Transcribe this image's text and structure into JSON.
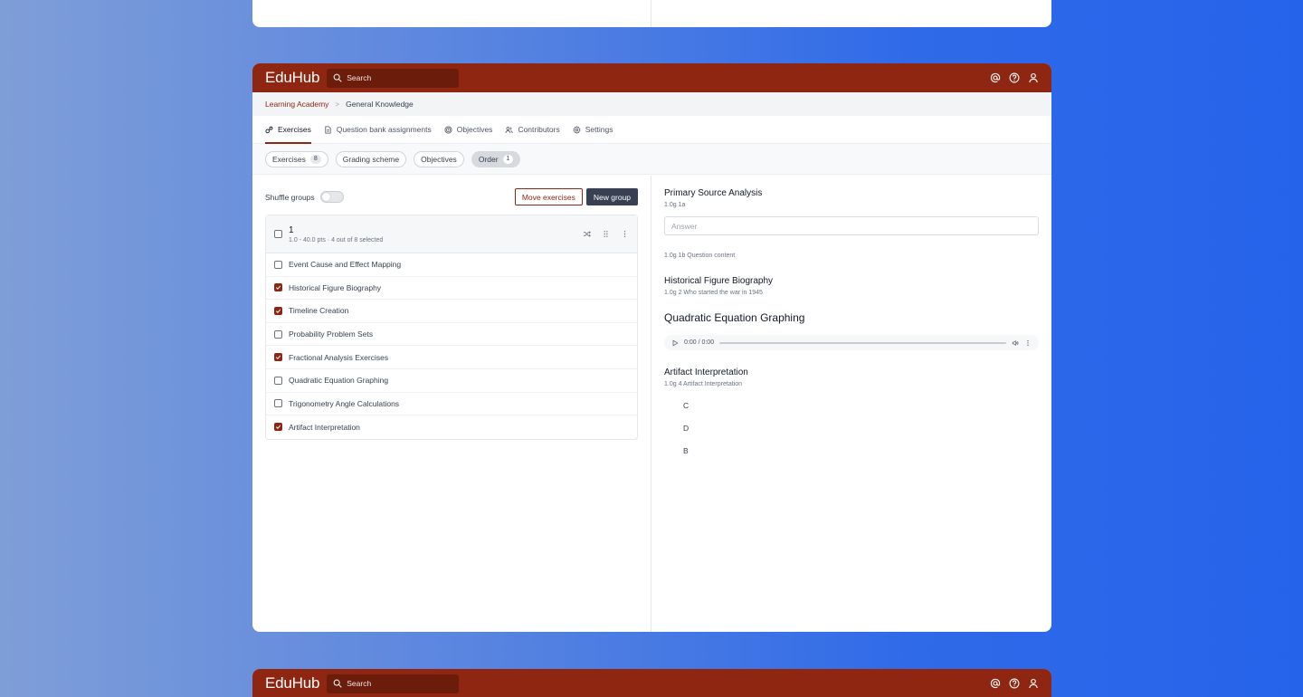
{
  "app": {
    "logo": "EduHub",
    "search_placeholder": "Search"
  },
  "breadcrumb": {
    "parent": "Learning Academy",
    "separator": ">",
    "current": "General Knowledge"
  },
  "tabs": [
    {
      "label": "Exercises",
      "icon": "exercises-icon",
      "active": true
    },
    {
      "label": "Question bank assignments",
      "icon": "document-icon"
    },
    {
      "label": "Objectives",
      "icon": "target-icon"
    },
    {
      "label": "Contributors",
      "icon": "users-icon"
    },
    {
      "label": "Settings",
      "icon": "gear-icon"
    }
  ],
  "pills": [
    {
      "label": "Exercises",
      "count": "8"
    },
    {
      "label": "Grading scheme"
    },
    {
      "label": "Objectives"
    },
    {
      "label": "Order",
      "count": "1",
      "active": true
    }
  ],
  "toolbar": {
    "shuffle_label": "Shuffle groups",
    "shuffle_on": false,
    "move_label": "Move exercises",
    "new_group_label": "New group"
  },
  "group": {
    "title": "1",
    "subtitle": "1.0 - 40.0 pts · 4 out of 8 selected",
    "items": [
      {
        "label": "Event Cause and Effect Mapping",
        "checked": false
      },
      {
        "label": "Historical Figure Biography",
        "checked": true
      },
      {
        "label": "Timeline Creation",
        "checked": true
      },
      {
        "label": "Probability Problem Sets",
        "checked": false
      },
      {
        "label": "Fractional Analysis Exercises",
        "checked": true
      },
      {
        "label": "Quadratic Equation Graphing",
        "checked": false
      },
      {
        "label": "Trigonometry Angle Calculations",
        "checked": false
      },
      {
        "label": "Artifact Interpretation",
        "checked": true
      }
    ]
  },
  "preview": {
    "q1": {
      "title": "Primary Source Analysis",
      "meta": "1.0g  1a",
      "answer_placeholder": "Answer",
      "meta2": "1.0g  1b  Question content"
    },
    "q2": {
      "title": "Historical Figure Biography",
      "meta": "1.0g  2  Who started the war in 1945"
    },
    "q3": {
      "title": "Quadratic Equation Graphing",
      "audio_time": "0:00 / 0:00"
    },
    "q4": {
      "title": "Artifact Interpretation",
      "meta": "1.0g  4  Artifact Interpretation",
      "options": [
        "C",
        "D",
        "B"
      ]
    }
  },
  "colors": {
    "brand": "#8e2612",
    "brand_dark": "#6b1c0a",
    "button_dark": "#374151"
  }
}
